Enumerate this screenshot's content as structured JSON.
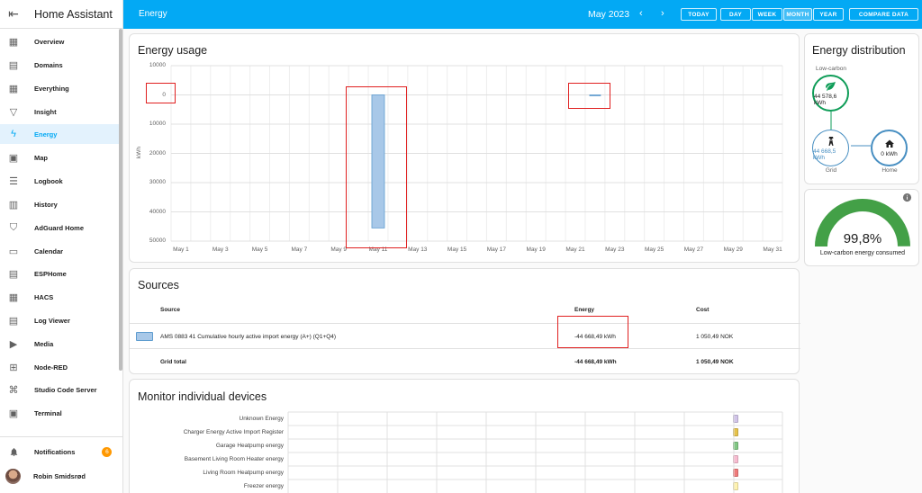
{
  "app": {
    "title": "Home Assistant",
    "menu_icon": "menu-open-icon"
  },
  "sidebar": {
    "items": [
      {
        "label": "Overview",
        "icon": "view-dashboard-icon",
        "glyph": "▦",
        "active": false
      },
      {
        "label": "Domains",
        "icon": "office-building-icon",
        "glyph": "▤",
        "active": false
      },
      {
        "label": "Everything",
        "icon": "view-dashboard-icon",
        "glyph": "▦",
        "active": false
      },
      {
        "label": "Insight",
        "icon": "filter-icon",
        "glyph": "▽",
        "active": false
      },
      {
        "label": "Energy",
        "icon": "lightning-bolt-icon",
        "glyph": "ϟ",
        "active": true
      },
      {
        "label": "Map",
        "icon": "map-icon",
        "glyph": "▣",
        "active": false
      },
      {
        "label": "Logbook",
        "icon": "list-icon",
        "glyph": "☰",
        "active": false
      },
      {
        "label": "History",
        "icon": "chart-box-icon",
        "glyph": "▥",
        "active": false
      },
      {
        "label": "AdGuard Home",
        "icon": "shield-check-icon",
        "glyph": "⛉",
        "active": false
      },
      {
        "label": "Calendar",
        "icon": "calendar-icon",
        "glyph": "▭",
        "active": false
      },
      {
        "label": "ESPHome",
        "icon": "chip-icon",
        "glyph": "▤",
        "active": false
      },
      {
        "label": "HACS",
        "icon": "hacs-icon",
        "glyph": "▦",
        "active": false
      },
      {
        "label": "Log Viewer",
        "icon": "text-box-icon",
        "glyph": "▤",
        "active": false
      },
      {
        "label": "Media",
        "icon": "play-box-icon",
        "glyph": "▶",
        "active": false
      },
      {
        "label": "Node-RED",
        "icon": "sitemap-icon",
        "glyph": "⊞",
        "active": false
      },
      {
        "label": "Studio Code Server",
        "icon": "code-icon",
        "glyph": "⌘",
        "active": false
      },
      {
        "label": "Terminal",
        "icon": "console-icon",
        "glyph": "▣",
        "active": false
      }
    ],
    "notifications": {
      "label": "Notifications",
      "count": "6",
      "icon": "bell-icon",
      "glyph": "🔔"
    },
    "user": {
      "name": "Robin Smidsrød"
    }
  },
  "topbar": {
    "title": "Energy",
    "period": "May 2023",
    "prev_glyph": "‹",
    "next_glyph": "›",
    "today": "TODAY",
    "day": "DAY",
    "week": "WEEK",
    "month": "MONTH",
    "year": "YEAR",
    "compare": "COMPARE DATA"
  },
  "energy_usage": {
    "title": "Energy usage",
    "chart_data": {
      "type": "bar",
      "ylabel": "kWh",
      "y_ticks": [
        "10000",
        "0",
        "10000",
        "20000",
        "30000",
        "40000",
        "50000"
      ],
      "x_ticks": [
        "May 1",
        "May 3",
        "May 5",
        "May 7",
        "May 9",
        "May 11",
        "May 13",
        "May 15",
        "May 17",
        "May 19",
        "May 21",
        "May 23",
        "May 25",
        "May 27",
        "May 29",
        "May 31"
      ],
      "series": [
        {
          "values": [
            {
              "x": "May 11",
              "y": 45500
            },
            {
              "x": "May 22",
              "y": 300
            }
          ]
        }
      ],
      "ylim": [
        -10000,
        50000
      ],
      "bar_color": "#a8c8e8",
      "bar_border": "#5e9ccf",
      "grid": true
    }
  },
  "sources": {
    "title": "Sources",
    "headers": {
      "source": "Source",
      "energy": "Energy",
      "cost": "Cost"
    },
    "rows": [
      {
        "name": "AMS 0883 41 Cumulative hourly active import energy (A+) (Q1+Q4)",
        "energy": "-44 668,49 kWh",
        "cost": "1 050,49 NOK",
        "color": "#a8c8e8"
      }
    ],
    "total": {
      "label": "Grid total",
      "energy": "-44 668,49 kWh",
      "cost": "1 050,49 NOK"
    }
  },
  "devices": {
    "title": "Monitor individual devices",
    "items": [
      {
        "label": "Unknown Energy",
        "color": "#d1c4e9"
      },
      {
        "label": "Charger Energy Active Import Register",
        "color": "#e6c24a"
      },
      {
        "label": "Garage Heatpump energy",
        "color": "#81c784"
      },
      {
        "label": "Basement Living Room Heater energy",
        "color": "#f8bbd0"
      },
      {
        "label": "Living Room Heatpump energy",
        "color": "#ef7a7a"
      },
      {
        "label": "Freezer energy",
        "color": "#fff3b0"
      }
    ]
  },
  "distribution": {
    "title": "Energy distribution",
    "low_carbon_label": "Low-carbon",
    "low_carbon_value": "44 578,6 kWh",
    "grid_label": "Grid",
    "grid_value": "44 668,5 kWh",
    "home_label": "Home",
    "home_value": "0 kWh",
    "green": "#0f9d58",
    "blue": "#488fc2"
  },
  "gauge": {
    "value": "99,8%",
    "fraction": 0.998,
    "label": "Low-carbon energy consumed",
    "info_icon": "information-icon",
    "color": "#43a047"
  }
}
